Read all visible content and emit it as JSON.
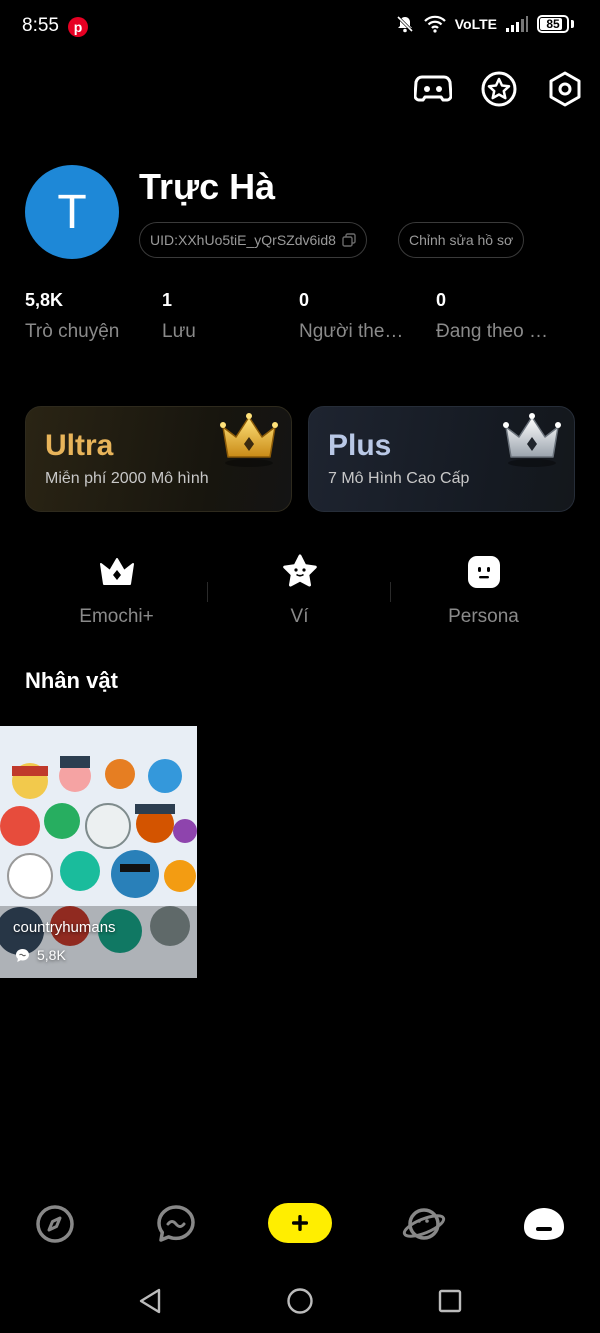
{
  "status_bar": {
    "time": "8:55",
    "network_label": "VoLTE",
    "battery_level": "85",
    "battery_percent": 85,
    "icons": [
      "pinterest-icon",
      "mute-icon",
      "wifi-icon",
      "signal-icon",
      "battery-icon"
    ]
  },
  "top_actions": [
    "discord-icon",
    "star-badge-icon",
    "settings-icon"
  ],
  "profile": {
    "avatar_initial": "T",
    "avatar_color": "#1e88d7",
    "name": "Trực Hà",
    "uid": "UID:XXhUo5tiE_yQrSZdv6id8",
    "edit_label": "Chỉnh sửa hồ sơ"
  },
  "stats": [
    {
      "value": "5,8K",
      "label": "Trò chuyện"
    },
    {
      "value": "1",
      "label": "Lưu"
    },
    {
      "value": "0",
      "label": "Người theo dõi"
    },
    {
      "value": "0",
      "label": "Đang theo dõi"
    }
  ],
  "membership": {
    "ultra": {
      "title": "Ultra",
      "subtitle": "Miễn phí 2000 Mô hình",
      "color": "#e8b45a"
    },
    "plus": {
      "title": "Plus",
      "subtitle": "7 Mô Hình Cao Cấp",
      "color": "#b9c8e6"
    }
  },
  "shortcuts": [
    {
      "label": "Emochi+",
      "icon": "crown-icon"
    },
    {
      "label": "Ví",
      "icon": "wallet-star-icon"
    },
    {
      "label": "Persona",
      "icon": "persona-face-icon"
    }
  ],
  "characters": {
    "section_title": "Nhân vật",
    "items": [
      {
        "name": "countryhumans",
        "chats": "5,8K"
      }
    ]
  },
  "bottom_nav": [
    "explore-icon",
    "chat-icon",
    "create-icon",
    "planet-icon",
    "profile-icon"
  ],
  "accent_color": "#ffee00"
}
